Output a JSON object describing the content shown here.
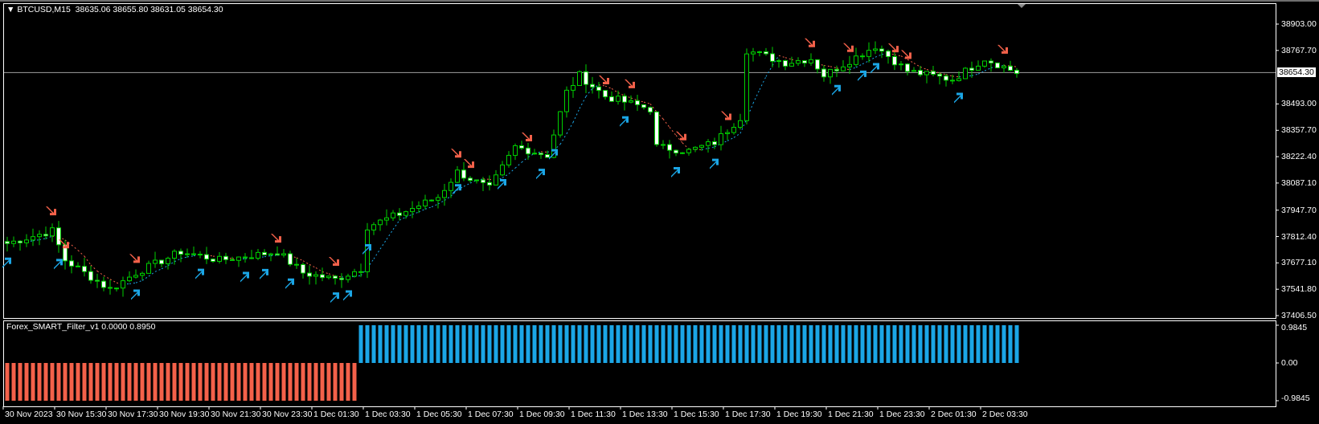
{
  "header": {
    "symbol_timeframe": "BTCUSD,M15",
    "ohlc": "38635.06 38655.80 38631.05 38654.30"
  },
  "indicator": {
    "title": "Forex_SMART_Filter_v1 0.0000 0.8950",
    "axis": [
      "0.9845",
      "0.00",
      "-0.9845"
    ],
    "axis_values": [
      0.9845,
      0,
      -0.9845
    ],
    "sell_color": "#f4614a",
    "buy_color": "#1ba6e6",
    "switch_index": 55
  },
  "chart_data": {
    "type": "candlestick",
    "symbol": "BTCUSD",
    "timeframe": "M15",
    "current_price": "38654.30",
    "current_price_value": 38654.3,
    "ylim": [
      37406.5,
      38903.0
    ],
    "price_ticks": [
      "38903.00",
      "38767.70",
      "38493.00",
      "38357.70",
      "38222.40",
      "38087.10",
      "37947.70",
      "37812.40",
      "37677.10",
      "37541.80",
      "37406.50"
    ],
    "bar_count": 158,
    "close_keypoints": [
      [
        0,
        37777
      ],
      [
        7,
        37842
      ],
      [
        9,
        37691
      ],
      [
        16,
        37540
      ],
      [
        20,
        37626
      ],
      [
        27,
        37734
      ],
      [
        33,
        37691
      ],
      [
        42,
        37734
      ],
      [
        46,
        37626
      ],
      [
        51,
        37592
      ],
      [
        55,
        37648
      ],
      [
        56,
        37864
      ],
      [
        61,
        37928
      ],
      [
        67,
        38015
      ],
      [
        70,
        38144
      ],
      [
        75,
        38058
      ],
      [
        79,
        38273
      ],
      [
        84,
        38230
      ],
      [
        87,
        38554
      ],
      [
        89,
        38640
      ],
      [
        93,
        38532
      ],
      [
        100,
        38467
      ],
      [
        101,
        38273
      ],
      [
        106,
        38252
      ],
      [
        110,
        38295
      ],
      [
        114,
        38424
      ],
      [
        115,
        38769
      ],
      [
        121,
        38705
      ],
      [
        125,
        38726
      ],
      [
        127,
        38640
      ],
      [
        135,
        38791
      ],
      [
        140,
        38662
      ],
      [
        147,
        38618
      ],
      [
        152,
        38726
      ],
      [
        157,
        38654
      ]
    ],
    "sell_signals": [
      7,
      9,
      20,
      42,
      51,
      70,
      72,
      81,
      93,
      97,
      105,
      112,
      125,
      131,
      138,
      140,
      155
    ],
    "buy_signals": [
      0,
      8,
      20,
      30,
      37,
      40,
      44,
      51,
      53,
      56,
      70,
      77,
      83,
      85,
      96,
      104,
      110,
      129,
      133,
      135,
      148
    ],
    "time_labels": [
      "30 Nov 2023",
      "30 Nov 15:30",
      "30 Nov 17:30",
      "30 Nov 19:30",
      "30 Nov 21:30",
      "30 Nov 23:30",
      "1 Dec 01:30",
      "1 Dec 03:30",
      "1 Dec 05:30",
      "1 Dec 07:30",
      "1 Dec 09:30",
      "1 Dec 11:30",
      "1 Dec 13:30",
      "1 Dec 15:30",
      "1 Dec 17:30",
      "1 Dec 19:30",
      "1 Dec 21:30",
      "1 Dec 23:30",
      "2 Dec 01:30",
      "2 Dec 03:30"
    ],
    "colors": {
      "candle_outline": "#00d000",
      "bull_body": "#000000",
      "bear_body": "#ffffff",
      "up_trend": "#1ba6e6",
      "down_trend": "#f4614a",
      "price_line": "#a0a0a0"
    }
  }
}
